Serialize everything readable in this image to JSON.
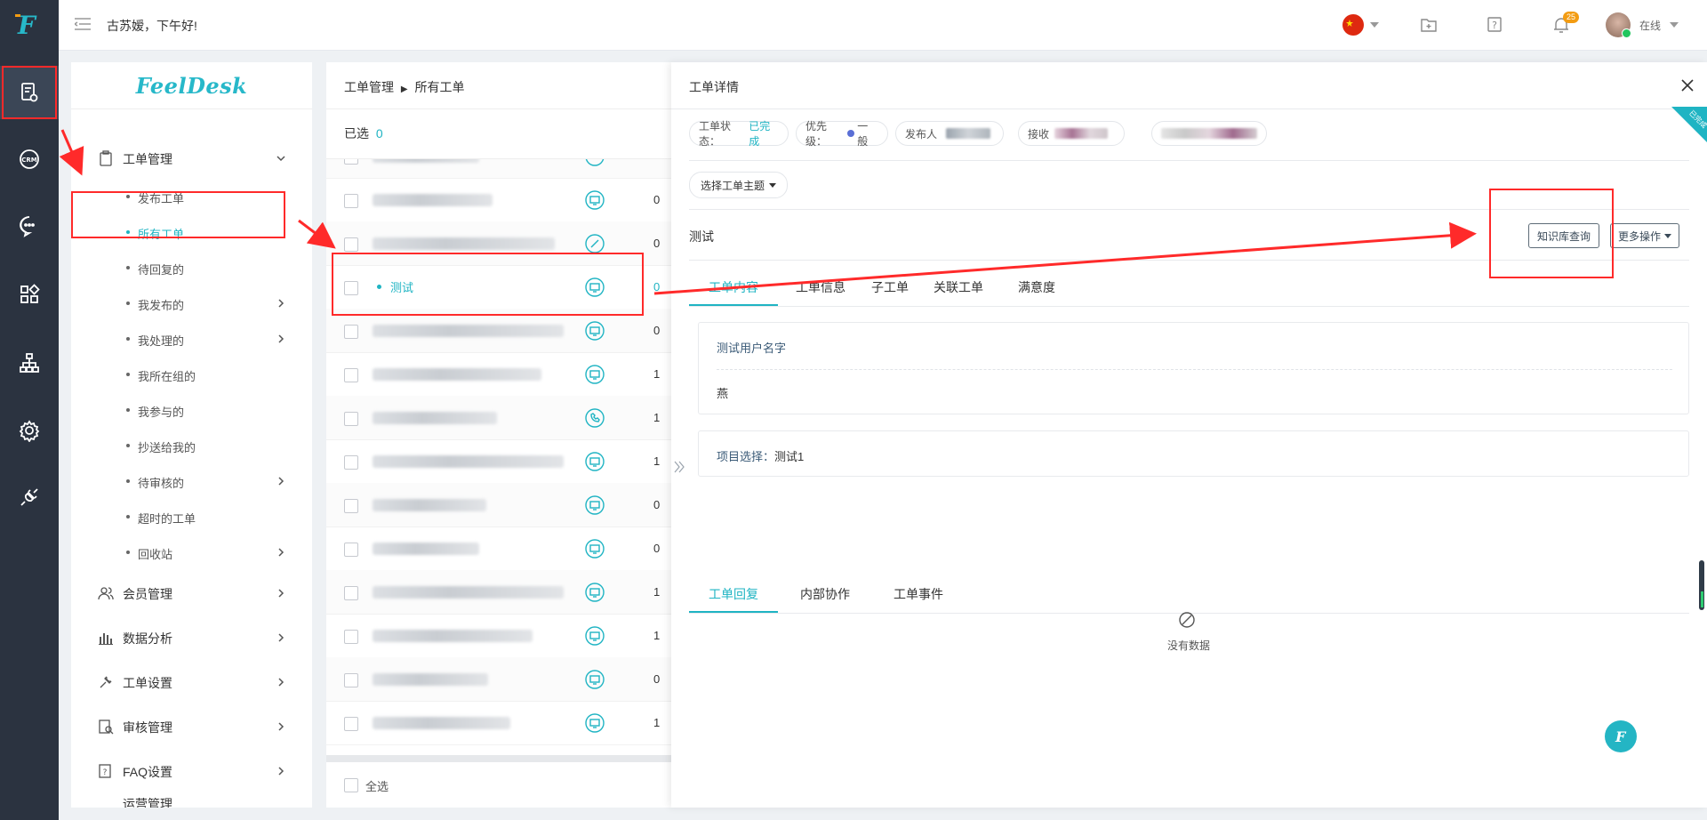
{
  "topbar": {
    "greeting": "古苏嫒，下午好!",
    "notification_count": "25",
    "user_status": "在线"
  },
  "sidebar": {
    "brand": "FeelDesk",
    "group_ticket": "工单管理",
    "items": [
      {
        "label": "发布工单"
      },
      {
        "label": "所有工单"
      },
      {
        "label": "待回复的"
      },
      {
        "label": "我发布的"
      },
      {
        "label": "我处理的"
      },
      {
        "label": "我所在组的"
      },
      {
        "label": "我参与的"
      },
      {
        "label": "抄送给我的"
      },
      {
        "label": "待审核的"
      },
      {
        "label": "超时的工单"
      },
      {
        "label": "回收站"
      }
    ],
    "groups": [
      {
        "label": "会员管理"
      },
      {
        "label": "数据分析"
      },
      {
        "label": "工单设置"
      },
      {
        "label": "审核管理"
      },
      {
        "label": "FAQ设置"
      },
      {
        "label": "运营管理"
      }
    ]
  },
  "list": {
    "breadcrumb_root": "工单管理",
    "breadcrumb_current": "所有工单",
    "selected_label": "已选",
    "selected_count": "0",
    "selected_row_title": "测试",
    "counts": [
      "0",
      "0",
      "0",
      "0",
      "1",
      "1",
      "1",
      "0",
      "0",
      "1",
      "1",
      "0",
      "1"
    ],
    "select_all": "全选"
  },
  "detail": {
    "title": "工单详情",
    "status_label": "工单状态：",
    "status_value": "已完成",
    "priority_label": "优先级：",
    "priority_value": "一般",
    "publisher_label": "发布人",
    "receiver_label": "接收",
    "theme_select": "选择工单主题",
    "subject": "测试",
    "kb_button": "知识库查询",
    "more_button": "更多操作",
    "tabs": [
      "工单内容",
      "工单信息",
      "子工单",
      "关联工单",
      "满意度"
    ],
    "field_label": "测试用户名字",
    "field_value": "燕",
    "project_label": "项目选择：",
    "project_value": "测试1",
    "reply_tabs": [
      "工单回复",
      "内部协作",
      "工单事件"
    ],
    "empty_text": "没有数据",
    "ribbon": "已完成"
  },
  "colors": {
    "accent": "#1fb4c3",
    "rail": "#2b3340",
    "annotation": "#ff2a2a"
  }
}
